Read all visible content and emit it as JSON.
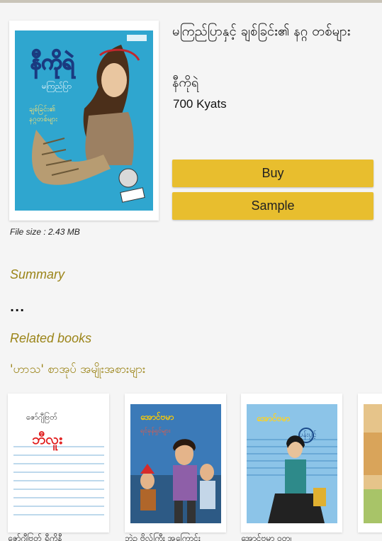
{
  "book": {
    "title": "မကြည်ပြာနှင့် ချစ်ခြင်း၏ နဂ္ဂ တစ်များ",
    "author": "နီကိုရဲ",
    "price": "700 Kyats",
    "cover_title": "နီကိုရဲ",
    "cover_subtitle_1": "မကြည်ပြာ",
    "cover_subtitle_2": "ချစ်ခြင်း၏",
    "cover_subtitle_3": "နဂ္ဂတစ်များ"
  },
  "actions": {
    "buy_label": "Buy",
    "sample_label": "Sample"
  },
  "file_size": "File size : 2.43 MB",
  "summary": {
    "heading": "Summary",
    "text": "..."
  },
  "related": {
    "heading": "Related books",
    "category_title": "'ဟာသ' စာအုပ် အမျိုးအစားများ",
    "books": [
      {
        "cover_author": "ဇော်ဂျီဗြတ်",
        "cover_title": "ဘီလူး",
        "caption": "ဇော်ဂျီဗြတ် ရီကိုနီ"
      },
      {
        "cover_author": "အောင်ဗမာ",
        "cover_title": "ရင်ခုန်ရှင်များ",
        "caption": "ဘဲဥ ဗိုလ်ကြီး အကြောင်း"
      },
      {
        "cover_author": "အောင်ဗမာ",
        "cover_title": "ပန်းပွင့်",
        "caption": "အောင်ဗမာ ဝတ္ထု"
      }
    ]
  },
  "colors": {
    "accent": "#e8be2e",
    "heading": "#9b8418",
    "background": "#f5f5f5"
  }
}
